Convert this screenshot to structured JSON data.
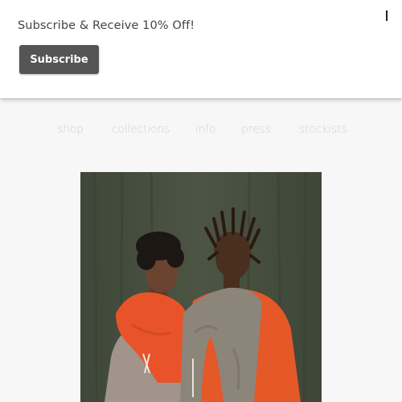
{
  "banner": {
    "message": "Subscribe & Receive 10% Off!",
    "subscribe_label": "Subscribe"
  },
  "nav": {
    "items": [
      {
        "label": "shop"
      },
      {
        "label": "collections"
      },
      {
        "label": "info"
      },
      {
        "label": "press"
      },
      {
        "label": "stockists"
      }
    ]
  },
  "colors": {
    "page_background": "#f7f7f7",
    "banner_background": "#ffffff",
    "button_background": "#555555",
    "button_text": "#ffffff",
    "nav_text": "#d2d2d2",
    "photo_backdrop": "#48503f",
    "scarf_orange": "#e8532a",
    "scarf_grey": "#8c857a"
  },
  "icons": {
    "close": "close-icon"
  }
}
